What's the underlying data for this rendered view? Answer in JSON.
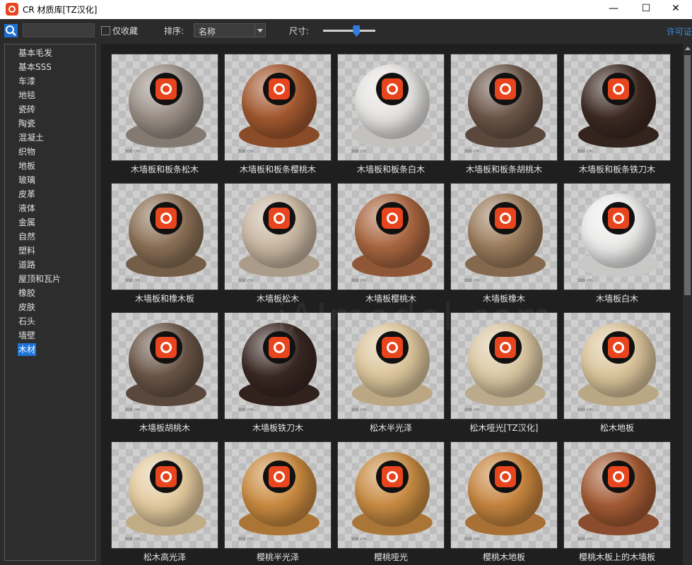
{
  "window": {
    "title": "CR 材质库[TZ汉化]",
    "minimize": "—",
    "maximize": "☐",
    "close": "✕"
  },
  "toolbar": {
    "search_value": "",
    "favorites_label": "仅收藏",
    "sort_label": "排序:",
    "sort_value": "名称",
    "size_label": "尺寸:",
    "size_level": 0.6,
    "license_label": "许可证"
  },
  "sidebar": {
    "categories": [
      "基本毛发",
      "基本SSS",
      "车漆",
      "地毯",
      "瓷砖",
      "陶瓷",
      "混凝土",
      "织物",
      "地板",
      "玻璃",
      "皮革",
      "液体",
      "金属",
      "自然",
      "塑料",
      "道路",
      "屋顶和瓦片",
      "橡胶",
      "皮肤",
      "石头",
      "墙壁",
      "木材"
    ],
    "selected": "木材"
  },
  "materials": [
    {
      "name": "木墙板和板条松木",
      "color": "#9a8f86"
    },
    {
      "name": "木墙板和板条樱桃木",
      "color": "#a2582f"
    },
    {
      "name": "木墙板和板条白木",
      "color": "#e6e4e1"
    },
    {
      "name": "木墙板和板条胡桃木",
      "color": "#6b5548"
    },
    {
      "name": "木墙板和板条铁刀木",
      "color": "#3d2a23"
    },
    {
      "name": "木墙板和橡木板",
      "color": "#8a6f55"
    },
    {
      "name": "木墙板松木",
      "color": "#c9b7a2"
    },
    {
      "name": "木墙板樱桃木",
      "color": "#a96640"
    },
    {
      "name": "木墙板橡木",
      "color": "#9b7b5c"
    },
    {
      "name": "木墙板白木",
      "color": "#ebebea"
    },
    {
      "name": "木墙板胡桃木",
      "color": "#6a5547"
    },
    {
      "name": "木墙板铁刀木",
      "color": "#3a2823"
    },
    {
      "name": "松木半光泽",
      "color": "#dcc59b"
    },
    {
      "name": "松木哑光[TZ汉化]",
      "color": "#dcc8a3"
    },
    {
      "name": "松木地板",
      "color": "#dbc49b"
    },
    {
      "name": "松木高光泽",
      "color": "#e3ca9e"
    },
    {
      "name": "樱桃半光泽",
      "color": "#c98a3f"
    },
    {
      "name": "樱桃哑光",
      "color": "#c88b42"
    },
    {
      "name": "樱桃木地板",
      "color": "#c6843e"
    },
    {
      "name": "樱桃木板上的木墙板",
      "color": "#a25a34"
    }
  ],
  "scale_text": "300 cm",
  "watermark": "iAImodel.com"
}
